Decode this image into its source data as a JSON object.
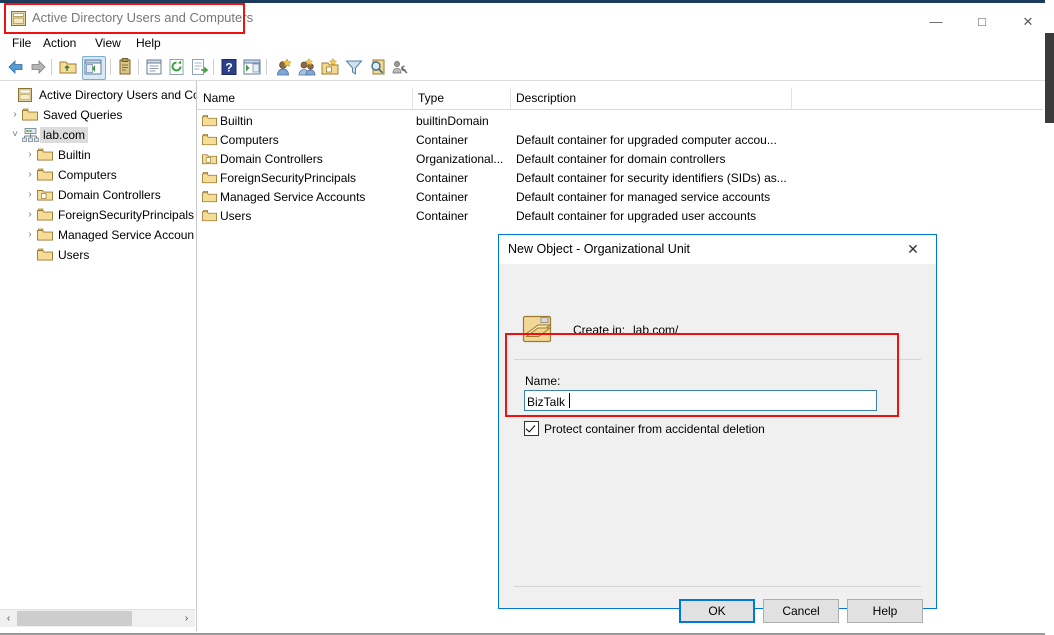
{
  "window": {
    "title": "Active Directory Users and Computers",
    "icon": "console-window-icon",
    "minimize_glyph": "—",
    "maximize_glyph": "□",
    "close_glyph": "✕"
  },
  "menubar": {
    "items": [
      {
        "label": "File",
        "name": "menu-file"
      },
      {
        "label": "Action",
        "name": "menu-action"
      },
      {
        "label": "View",
        "name": "menu-view"
      },
      {
        "label": "Help",
        "name": "menu-help"
      }
    ]
  },
  "toolbar": {
    "icons": [
      "back-arrow-icon",
      "forward-arrow-icon",
      "up-one-level-folder-icon",
      "show-hide-console-tree-icon",
      "properties-clipboard-icon",
      "properties-window-icon",
      "refresh-icon",
      "export-list-icon",
      "help-icon",
      "show-hide-action-pane-icon",
      "find-user-icon",
      "new-user-icon",
      "new-group-icon",
      "new-organizational-unit-icon",
      "filter-icon",
      "search-magnifier-icon",
      "advanced-features-icon"
    ]
  },
  "tree": {
    "items": [
      {
        "label": "Active Directory Users and Com",
        "indent": 0,
        "twisty": "",
        "icon": "console-root-icon",
        "selected": false
      },
      {
        "label": "Saved Queries",
        "indent": 1,
        "twisty": "›",
        "icon": "folder-icon",
        "selected": false
      },
      {
        "label": "lab.com",
        "indent": 1,
        "twisty": "˅",
        "icon": "domain-icon",
        "selected": true
      },
      {
        "label": "Builtin",
        "indent": 2,
        "twisty": "›",
        "icon": "folder-icon",
        "selected": false
      },
      {
        "label": "Computers",
        "indent": 2,
        "twisty": "›",
        "icon": "folder-icon",
        "selected": false
      },
      {
        "label": "Domain Controllers",
        "indent": 2,
        "twisty": "›",
        "icon": "ou-folder-icon",
        "selected": false
      },
      {
        "label": "ForeignSecurityPrincipals",
        "indent": 2,
        "twisty": "›",
        "icon": "folder-icon",
        "selected": false
      },
      {
        "label": "Managed Service Accoun",
        "indent": 2,
        "twisty": "›",
        "icon": "folder-icon",
        "selected": false
      },
      {
        "label": "Users",
        "indent": 2,
        "twisty": "",
        "icon": "folder-icon",
        "selected": false
      }
    ],
    "hscroll": {
      "left_arrow": "‹",
      "right_arrow": "›"
    }
  },
  "list": {
    "columns": [
      {
        "label": "Name"
      },
      {
        "label": "Type"
      },
      {
        "label": "Description"
      }
    ],
    "rows": [
      {
        "name": "Builtin",
        "type": "builtinDomain",
        "description": "",
        "icon": "folder-icon"
      },
      {
        "name": "Computers",
        "type": "Container",
        "description": "Default container for upgraded computer accou...",
        "icon": "folder-icon"
      },
      {
        "name": "Domain Controllers",
        "type": "Organizational...",
        "description": "Default container for domain controllers",
        "icon": "ou-folder-icon"
      },
      {
        "name": "ForeignSecurityPrincipals",
        "type": "Container",
        "description": "Default container for security identifiers (SIDs) as...",
        "icon": "folder-icon"
      },
      {
        "name": "Managed Service Accounts",
        "type": "Container",
        "description": "Default container for managed service accounts",
        "icon": "folder-icon"
      },
      {
        "name": "Users",
        "type": "Container",
        "description": "Default container for upgraded user accounts",
        "icon": "folder-icon"
      }
    ]
  },
  "dialog": {
    "title": "New Object - Organizational Unit",
    "close_glyph": "✕",
    "create_in_label": "Create in:",
    "create_in_value": "lab.com/",
    "create_in_icon": "ou-folder-large-icon",
    "name_label": "Name:",
    "name_value": "BizTalk",
    "name_placeholder": "",
    "protect_label": "Protect container from accidental deletion",
    "protect_checked": true,
    "buttons": {
      "ok": "OK",
      "cancel": "Cancel",
      "help": "Help"
    }
  },
  "annotations": {
    "color": "#ee1111",
    "boxes": [
      {
        "name": "annot-title"
      },
      {
        "name": "annot-name"
      }
    ]
  }
}
